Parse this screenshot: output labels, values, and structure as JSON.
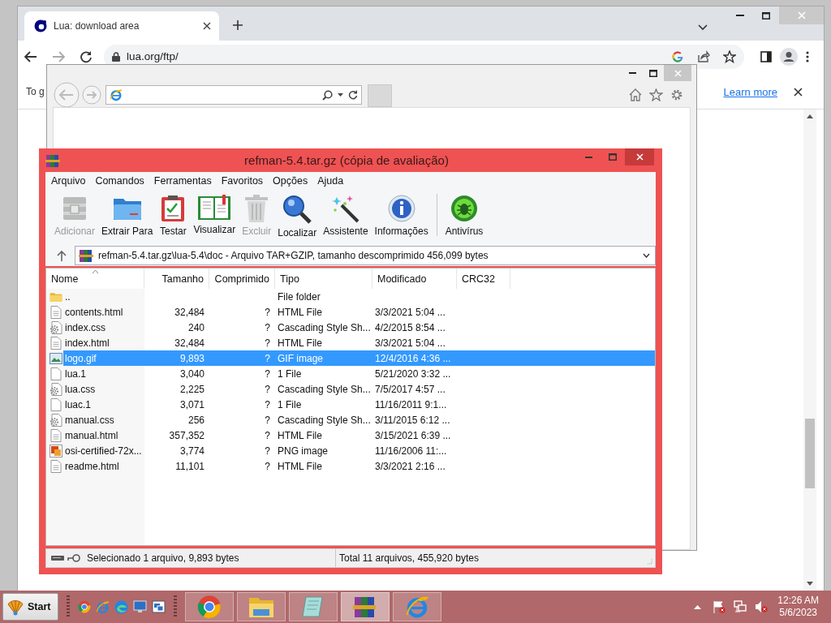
{
  "browser": {
    "tabs": [
      {
        "title": "Lua: download area",
        "selected": true
      }
    ],
    "address": "lua.org/ftp/",
    "infobar": {
      "text": "To g",
      "link": "Learn more"
    }
  },
  "archiver": {
    "title": "refman-5.4.tar.gz (cópia de avaliação)",
    "menu": [
      "Arquivo",
      "Comandos",
      "Ferramentas",
      "Favoritos",
      "Opções",
      "Ajuda"
    ],
    "toolbar": [
      {
        "label": "Adicionar",
        "kind": "add",
        "disabled": true
      },
      {
        "label": "Extrair Para",
        "kind": "extract",
        "disabled": false
      },
      {
        "label": "Testar",
        "kind": "test",
        "disabled": false
      },
      {
        "label": "Visualizar",
        "kind": "view",
        "disabled": false
      },
      {
        "label": "Excluir",
        "kind": "delete",
        "disabled": true
      },
      {
        "label": "Localizar",
        "kind": "find",
        "disabled": false
      },
      {
        "label": "Assistente",
        "kind": "wizard",
        "disabled": false
      },
      {
        "label": "Informações",
        "kind": "info",
        "disabled": false
      },
      {
        "label": "Antivírus",
        "kind": "antivirus",
        "disabled": false
      }
    ],
    "path": "refman-5.4.tar.gz\\lua-5.4\\doc - Arquivo TAR+GZIP, tamanho descomprimido 456,099 bytes",
    "columns": [
      "Nome",
      "Tamanho",
      "Comprimido",
      "Tipo",
      "Modificado",
      "CRC32"
    ],
    "rows": [
      {
        "kind": "folder",
        "name": "..",
        "size": "",
        "packed": "",
        "type": "File folder",
        "modified": "",
        "selected": false
      },
      {
        "kind": "doc",
        "name": "contents.html",
        "size": "32,484",
        "packed": "?",
        "type": "HTML File",
        "modified": "3/3/2021 5:04 ...",
        "selected": false
      },
      {
        "kind": "css",
        "name": "index.css",
        "size": "240",
        "packed": "?",
        "type": "Cascading Style Sh...",
        "modified": "4/2/2015 8:54 ...",
        "selected": false
      },
      {
        "kind": "doc",
        "name": "index.html",
        "size": "32,484",
        "packed": "?",
        "type": "HTML File",
        "modified": "3/3/2021 5:04 ...",
        "selected": false
      },
      {
        "kind": "gif",
        "name": "logo.gif",
        "size": "9,893",
        "packed": "?",
        "type": "GIF image",
        "modified": "12/4/2016 4:36 ...",
        "selected": true
      },
      {
        "kind": "plain",
        "name": "lua.1",
        "size": "3,040",
        "packed": "?",
        "type": "1 File",
        "modified": "5/21/2020 3:32 ...",
        "selected": false
      },
      {
        "kind": "css",
        "name": "lua.css",
        "size": "2,225",
        "packed": "?",
        "type": "Cascading Style Sh...",
        "modified": "7/5/2017 4:57 ...",
        "selected": false
      },
      {
        "kind": "plain",
        "name": "luac.1",
        "size": "3,071",
        "packed": "?",
        "type": "1 File",
        "modified": "11/16/2011 9:1...",
        "selected": false
      },
      {
        "kind": "css",
        "name": "manual.css",
        "size": "256",
        "packed": "?",
        "type": "Cascading Style Sh...",
        "modified": "3/11/2015 6:12 ...",
        "selected": false
      },
      {
        "kind": "doc",
        "name": "manual.html",
        "size": "357,352",
        "packed": "?",
        "type": "HTML File",
        "modified": "3/15/2021 6:39 ...",
        "selected": false
      },
      {
        "kind": "png",
        "name": "osi-certified-72x...",
        "size": "3,774",
        "packed": "?",
        "type": "PNG image",
        "modified": "11/16/2006 11:...",
        "selected": false
      },
      {
        "kind": "doc",
        "name": "readme.html",
        "size": "11,101",
        "packed": "?",
        "type": "HTML File",
        "modified": "3/3/2021 2:16 ...",
        "selected": false
      }
    ],
    "status_left": "Selecionado 1 arquivo, 9,893 bytes",
    "status_right": "Total 11 arquivos, 455,920 bytes"
  },
  "taskbar": {
    "start": "Start",
    "apps": [
      {
        "kind": "chrome",
        "selected": false
      },
      {
        "kind": "explorer",
        "selected": false
      },
      {
        "kind": "notepad",
        "selected": false
      },
      {
        "kind": "winrar",
        "selected": true
      },
      {
        "kind": "ie",
        "selected": false
      }
    ],
    "time": "12:26 AM",
    "date": "5/6/2023"
  }
}
